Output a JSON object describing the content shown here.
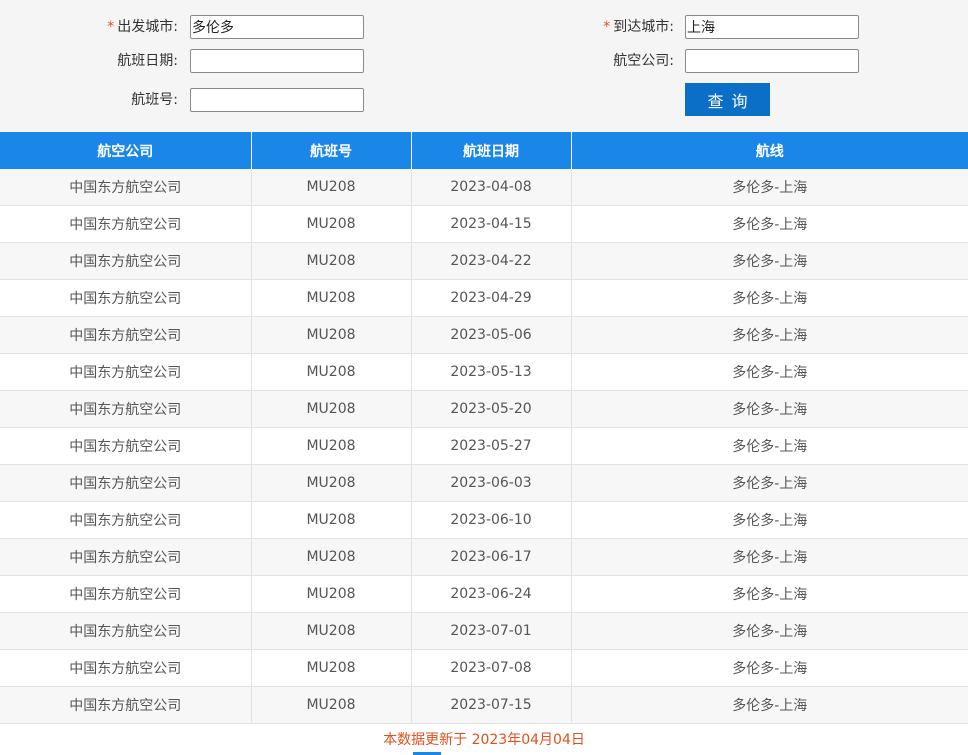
{
  "form": {
    "departure_label": "出发城市:",
    "departure_value": "多伦多",
    "arrival_label": "到达城市:",
    "arrival_value": "上海",
    "date_label": "航班日期:",
    "date_value": "",
    "airline_label": "航空公司:",
    "airline_value": "",
    "flight_no_label": "航班号:",
    "flight_no_value": "",
    "required_mark": "*",
    "search_button": "查询"
  },
  "table": {
    "headers": [
      "航空公司",
      "航班号",
      "航班日期",
      "航线"
    ],
    "rows": [
      [
        "中国东方航空公司",
        "MU208",
        "2023-04-08",
        "多伦多-上海"
      ],
      [
        "中国东方航空公司",
        "MU208",
        "2023-04-15",
        "多伦多-上海"
      ],
      [
        "中国东方航空公司",
        "MU208",
        "2023-04-22",
        "多伦多-上海"
      ],
      [
        "中国东方航空公司",
        "MU208",
        "2023-04-29",
        "多伦多-上海"
      ],
      [
        "中国东方航空公司",
        "MU208",
        "2023-05-06",
        "多伦多-上海"
      ],
      [
        "中国东方航空公司",
        "MU208",
        "2023-05-13",
        "多伦多-上海"
      ],
      [
        "中国东方航空公司",
        "MU208",
        "2023-05-20",
        "多伦多-上海"
      ],
      [
        "中国东方航空公司",
        "MU208",
        "2023-05-27",
        "多伦多-上海"
      ],
      [
        "中国东方航空公司",
        "MU208",
        "2023-06-03",
        "多伦多-上海"
      ],
      [
        "中国东方航空公司",
        "MU208",
        "2023-06-10",
        "多伦多-上海"
      ],
      [
        "中国东方航空公司",
        "MU208",
        "2023-06-17",
        "多伦多-上海"
      ],
      [
        "中国东方航空公司",
        "MU208",
        "2023-06-24",
        "多伦多-上海"
      ],
      [
        "中国东方航空公司",
        "MU208",
        "2023-07-01",
        "多伦多-上海"
      ],
      [
        "中国东方航空公司",
        "MU208",
        "2023-07-08",
        "多伦多-上海"
      ],
      [
        "中国东方航空公司",
        "MU208",
        "2023-07-15",
        "多伦多-上海"
      ]
    ]
  },
  "footer": {
    "update_note": "本数据更新于 2023年04月04日"
  },
  "colors": {
    "header_bg": "#1a87e8",
    "button_bg": "#0c6fc7",
    "required_mark": "#e0521c",
    "footer_text": "#e0521c"
  }
}
